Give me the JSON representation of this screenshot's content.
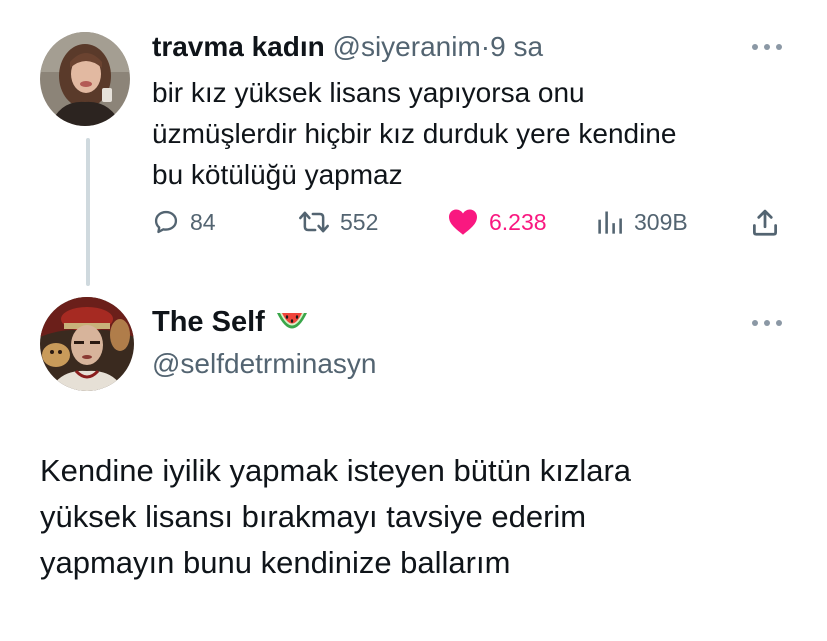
{
  "tweet1": {
    "author_name": "travma kadın",
    "handle": "@siyeranim",
    "separator": "·",
    "time": "9 sa",
    "text_lines": [
      "bir kız yüksek lisans yapıyorsa onu",
      "üzmüşlerdir hiçbir kız durduk yere kendine",
      "bu kötülüğü yapmaz"
    ],
    "actions": {
      "replies": "84",
      "retweets": "552",
      "likes": "6.238",
      "views": "309B"
    },
    "icons": [
      "reply-icon",
      "retweet-icon",
      "heart-icon",
      "views-icon",
      "share-icon",
      "more-icon"
    ],
    "like_color": "#f91880"
  },
  "tweet2": {
    "author_name": "The Self",
    "handle": "@selfdetrminasyn",
    "badge_icon": "watermelon-icon",
    "text_lines": [
      "Kendine iyilik yapmak isteyen bütün kızlara",
      "yüksek lisansı bırakmayı tavsiye ederim",
      "yapmayın bunu kendinize ballarım"
    ]
  },
  "colors": {
    "text": "#0f1419",
    "secondary": "#536471",
    "thread_line": "#cfd9de"
  }
}
